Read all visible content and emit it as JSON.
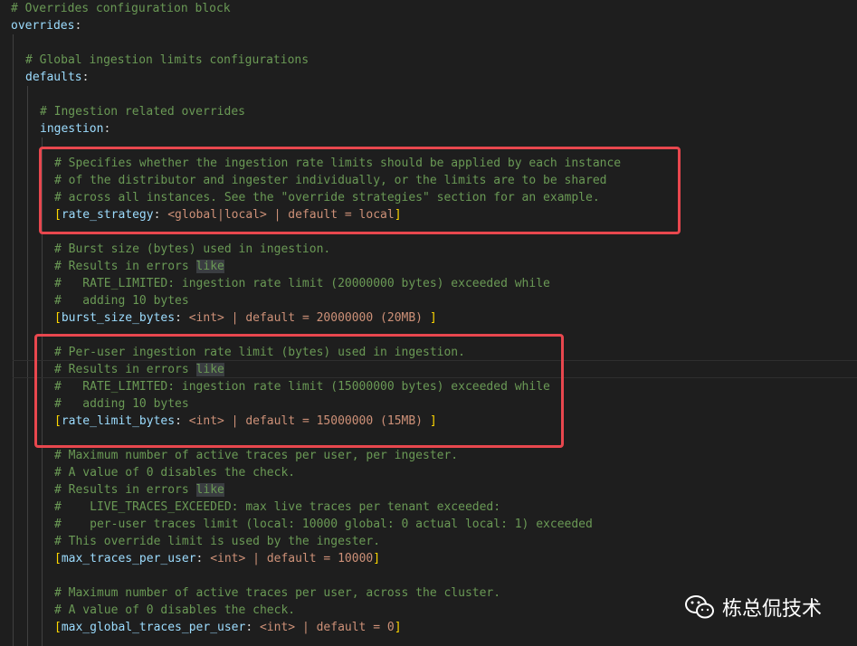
{
  "lines": {
    "l1": "# Overrides configuration block",
    "l2_key": "overrides",
    "l4": "# Global ingestion limits configurations",
    "l5_key": "defaults",
    "l7": "# Ingestion related overrides",
    "l8_key": "ingestion",
    "l10": "# Specifies whether the ingestion rate limits should be applied by each instance",
    "l11": "# of the distributor and ingester individually, or the limits are to be shared",
    "l12": "# across all instances. See the \"override strategies\" section for an example.",
    "l13_key": "rate_strategy",
    "l13_val": "<global|local> | default = local",
    "l15": "# Burst size (bytes) used in ingestion.",
    "l16_pre": "# Results in errors ",
    "like": "like",
    "l17": "#   RATE_LIMITED: ingestion rate limit (20000000 bytes) exceeded while",
    "l18": "#   adding 10 bytes",
    "l19_key": "burst_size_bytes",
    "l19_val": "<int> | default = 20000000 (20MB) ",
    "l21": "# Per-user ingestion rate limit (bytes) used in ingestion.",
    "l22_pre": "# Results in errors ",
    "l23": "#   RATE_LIMITED: ingestion rate limit (15000000 bytes) exceeded while",
    "l24": "#   adding 10 bytes",
    "l25_key": "rate_limit_bytes",
    "l25_val": "<int> | default = 15000000 (15MB) ",
    "l27": "# Maximum number of active traces per user, per ingester.",
    "l28": "# A value of 0 disables the check.",
    "l29_pre": "# Results in errors ",
    "l30": "#    LIVE_TRACES_EXCEEDED: max live traces per tenant exceeded:",
    "l31": "#    per-user traces limit (local: 10000 global: 0 actual local: 1) exceeded",
    "l32": "# This override limit is used by the ingester.",
    "l33_key": "max_traces_per_user",
    "l33_val": "<int> | default = 10000",
    "l35": "# Maximum number of active traces per user, across the cluster.",
    "l36": "# A value of 0 disables the check.",
    "l37_key": "max_global_traces_per_user",
    "l37_val": "<int> | default = 0"
  },
  "punct": {
    "colon": ":",
    "lbr": "[",
    "rbr": "]",
    "colon_sp": ": "
  },
  "watermark": {
    "text": "栋总侃技术",
    "icon": "wechat-icon"
  },
  "colors": {
    "comment": "#6a9955",
    "key": "#9cdcfe",
    "value": "#ce9178",
    "highlight_box": "#e8474e"
  }
}
